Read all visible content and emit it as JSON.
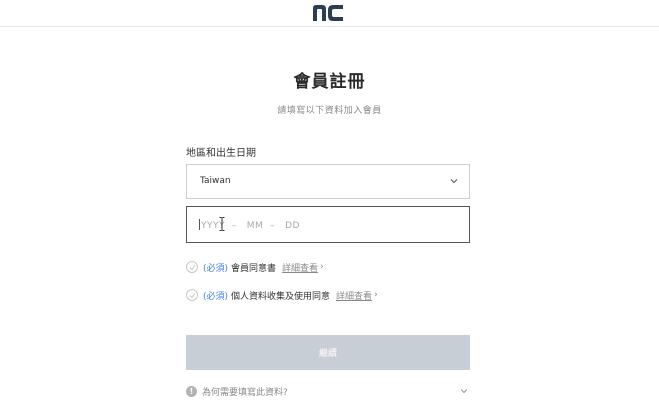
{
  "header": {
    "logo_text": "nc",
    "logo_icon": "nc-logo"
  },
  "page": {
    "title": "會員註冊",
    "subtitle": "請填寫以下資料加入會員"
  },
  "region_section": {
    "label": "地區和出生日期",
    "country_value": "Taiwan",
    "date_placeholder": "YYYY  –   MM  –   DD"
  },
  "agreements": [
    {
      "required_tag": "(必須)",
      "label": "會員同意書",
      "link": "詳細查看"
    },
    {
      "required_tag": "(必須)",
      "label": "個人資料收集及使用同意",
      "link": "詳細查看"
    }
  ],
  "next_button": {
    "label": "繼續"
  },
  "faq": {
    "label": "為何需要填寫此資料?"
  },
  "colors": {
    "accent": "#3d7ef0",
    "button_disabled": "#c8ced6",
    "logo": "#2a3d55"
  }
}
